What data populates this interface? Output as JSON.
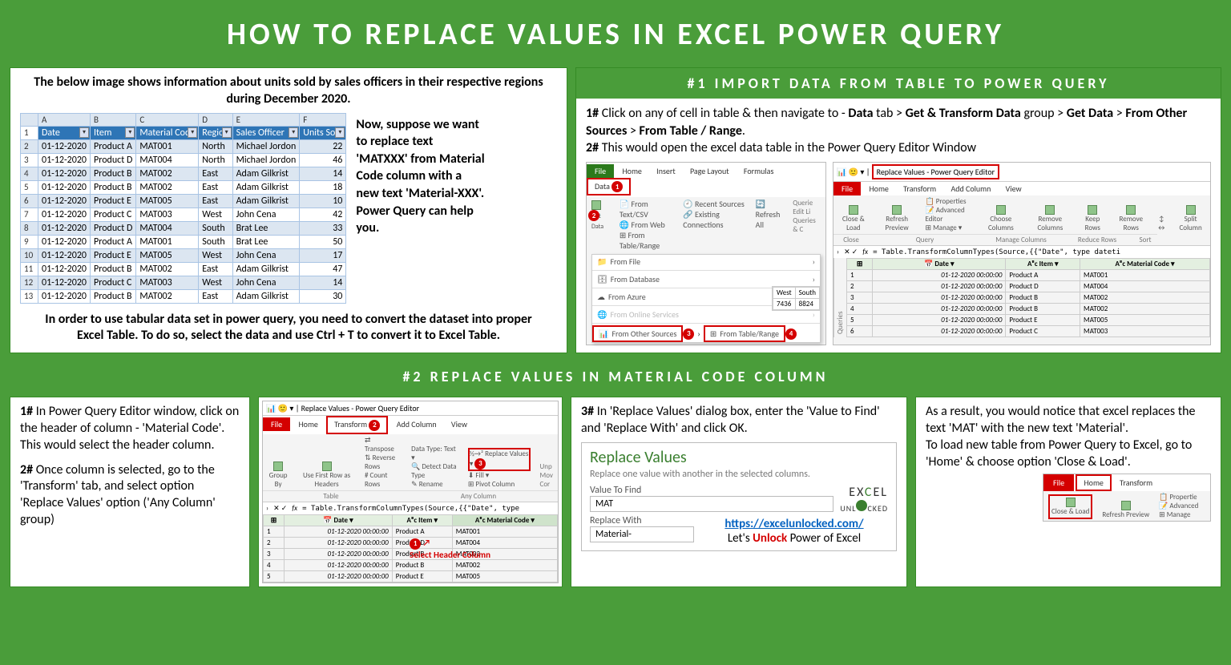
{
  "title": "HOW TO REPLACE VALUES IN EXCEL POWER QUERY",
  "intro": "The below image shows information about units sold by sales officers in their respective regions during December 2020.",
  "sidecopy": "Now, suppose we want to replace text 'MATXXX' from Material Code column with a new text 'Material-XXX'. Power Query can help you.",
  "outro": "In order to use tabular data set in power query, you need to convert the dataset into proper Excel Table. To do so, select the data and use Ctrl + T to convert it to Excel Table.",
  "cols_letters": [
    "A",
    "B",
    "C",
    "D",
    "E",
    "F"
  ],
  "headers": [
    "Date",
    "Item",
    "Material Code",
    "Region",
    "Sales Officer",
    "Units Sold"
  ],
  "rows": [
    [
      "01-12-2020",
      "Product A",
      "MAT001",
      "North",
      "Michael Jordon",
      "22"
    ],
    [
      "01-12-2020",
      "Product D",
      "MAT004",
      "North",
      "Michael Jordon",
      "46"
    ],
    [
      "01-12-2020",
      "Product B",
      "MAT002",
      "East",
      "Adam Gilkrist",
      "14"
    ],
    [
      "01-12-2020",
      "Product B",
      "MAT002",
      "East",
      "Adam Gilkrist",
      "18"
    ],
    [
      "01-12-2020",
      "Product E",
      "MAT005",
      "East",
      "Adam Gilkrist",
      "10"
    ],
    [
      "01-12-2020",
      "Product C",
      "MAT003",
      "West",
      "John Cena",
      "42"
    ],
    [
      "01-12-2020",
      "Product D",
      "MAT004",
      "South",
      "Brat Lee",
      "33"
    ],
    [
      "01-12-2020",
      "Product A",
      "MAT001",
      "South",
      "Brat Lee",
      "50"
    ],
    [
      "01-12-2020",
      "Product E",
      "MAT005",
      "West",
      "John Cena",
      "17"
    ],
    [
      "01-12-2020",
      "Product B",
      "MAT002",
      "East",
      "Adam Gilkrist",
      "47"
    ],
    [
      "01-12-2020",
      "Product C",
      "MAT003",
      "West",
      "John Cena",
      "14"
    ],
    [
      "01-12-2020",
      "Product B",
      "MAT002",
      "East",
      "Adam Gilkrist",
      "30"
    ]
  ],
  "sec1_head": "#1 IMPORT DATA FROM TABLE TO POWER QUERY",
  "sec1_step1_pre": "1# ",
  "sec1_step1_a": "Click on any of cell in table & then navigate to - ",
  "sec1_step1_b": "Data",
  "sec1_step1_c": " tab > ",
  "sec1_step1_d": "Get & Transform Data",
  "sec1_step1_e": " group > ",
  "sec1_step1_f": "Get Data",
  "sec1_step1_g": " > ",
  "sec1_step1_h": "From Other Sources",
  "sec1_step1_i": " > ",
  "sec1_step1_j": "From Table / Range",
  "sec1_step1_k": ".",
  "sec1_step2_pre": "2# ",
  "sec1_step2": "This would open the excel data table in the Power Query Editor Window",
  "excel_tabs": {
    "file": "File",
    "home": "Home",
    "insert": "Insert",
    "layout": "Page Layout",
    "formulas": "Formulas",
    "data": "Data"
  },
  "excel_items": {
    "fromtxt": "From Text/CSV",
    "fromweb": "From Web",
    "fromtbl": "From Table/Range",
    "recent": "Recent Sources",
    "existing": "Existing Connections",
    "refresh": "Refresh All",
    "queries": "Querie",
    "editli": "Edit Li",
    "qc": "Queries & C",
    "getdata": "Get Data"
  },
  "getdata_menu": [
    "From File",
    "From Database",
    "From Azure",
    "From Online Services",
    "From Other Sources"
  ],
  "from_table_range": "From Table/Range",
  "mini_vals": {
    "west": "West",
    "south": "South",
    "v1": "7436",
    "v2": "8824"
  },
  "pq_title": "Replace Values - Power Query Editor",
  "pq_tabs": {
    "file": "File",
    "home": "Home",
    "transform": "Transform",
    "addcol": "Add Column",
    "view": "View"
  },
  "pq_ribbon": {
    "close": "Close & Load",
    "refresh": "Refresh Preview",
    "props": "Properties",
    "adv": "Advanced Editor",
    "manage": "Manage",
    "choose": "Choose Columns",
    "remove": "Remove Columns",
    "keep": "Keep Rows",
    "rrows": "Remove Rows",
    "split": "Split Column",
    "g_close": "Close",
    "g_query": "Query",
    "g_cols": "Manage Columns",
    "g_rows": "Reduce Rows",
    "g_sort": "Sort"
  },
  "pq_formula": "= Table.TransformColumnTypes(Source,{{\"Date\", type dateti",
  "pq_cols": [
    "Date",
    "Item",
    "Material Code"
  ],
  "pq_rows": [
    [
      "1",
      "01-12-2020 00:00:00",
      "Product A",
      "MAT001"
    ],
    [
      "2",
      "01-12-2020 00:00:00",
      "Product D",
      "MAT004"
    ],
    [
      "3",
      "01-12-2020 00:00:00",
      "Product B",
      "MAT002"
    ],
    [
      "4",
      "01-12-2020 00:00:00",
      "Product B",
      "MAT002"
    ],
    [
      "5",
      "01-12-2020 00:00:00",
      "Product E",
      "MAT005"
    ],
    [
      "6",
      "01-12-2020 00:00:00",
      "Product C",
      "MAT003"
    ]
  ],
  "sec2_head": "#2 REPLACE VALUES IN MATERIAL CODE COLUMN",
  "sec2_p1_pre": "1# ",
  "sec2_p1": "In Power Query Editor window, click on the header of column - 'Material Code'. This would select the header column.",
  "sec2_p2_pre": "2# ",
  "sec2_p2": "Once column is selected, go to the 'Transform' tab, and select option 'Replace Values' option ('Any Column' group)",
  "sec2_p3_pre": "3# ",
  "sec2_p3": "In 'Replace Values' dialog box, enter the 'Value to Find' and 'Replace With' and click OK.",
  "sec2_result": "As a result, you would notice that excel replaces the text 'MAT' with the new text 'Material'.\nTo load new table from Power Query to Excel, go to 'Home' & choose option 'Close & Load'.",
  "transform_ribbon": {
    "group": "Group By",
    "usefirst": "Use First Row as Headers",
    "transpose": "Transpose",
    "reverse": "Reverse Rows",
    "count": "Count Rows",
    "datatype": "Data Type: Text",
    "detect": "Detect Data Type",
    "rename": "Rename",
    "replace": "Replace Values",
    "fill": "Fill",
    "pivot": "Pivot Column",
    "unp": "Unp",
    "mov": "Mov",
    "cor": "Cor",
    "g_table": "Table",
    "g_any": "Any Column"
  },
  "pq2_formula": "= Table.TransformColumnTypes(Source,{{\"Date\", type",
  "callout": "Select Header Column",
  "pq2_rows": [
    [
      "1",
      "01-12-2020 00:00:00",
      "Product A",
      "MAT001"
    ],
    [
      "2",
      "01-12-2020 00:00:00",
      "Product D",
      "MAT004"
    ],
    [
      "3",
      "01-12-2020 00:00:00",
      "Product B",
      "MAT002"
    ],
    [
      "4",
      "01-12-2020 00:00:00",
      "Product B",
      "MAT002"
    ],
    [
      "5",
      "01-12-2020 00:00:00",
      "Product E",
      "MAT005"
    ]
  ],
  "dlg": {
    "title": "Replace Values",
    "sub": "Replace one value with another in the selected columns.",
    "lbl_find": "Value To Find",
    "val_find": "MAT",
    "lbl_repl": "Replace With",
    "val_repl": "Material-"
  },
  "brand": {
    "logo": "EXCEL UNLOCKED",
    "url": "https://excelunlocked.com/",
    "tag_a": "Let's ",
    "tag_b": "Unlock",
    "tag_c": " Power of Excel"
  },
  "load_mock": {
    "file": "File",
    "home": "Home",
    "transform": "Transform",
    "close": "Close & Load",
    "refresh": "Refresh Preview",
    "props": "Propertie",
    "adv": "Advanced",
    "manage": "Manage"
  }
}
